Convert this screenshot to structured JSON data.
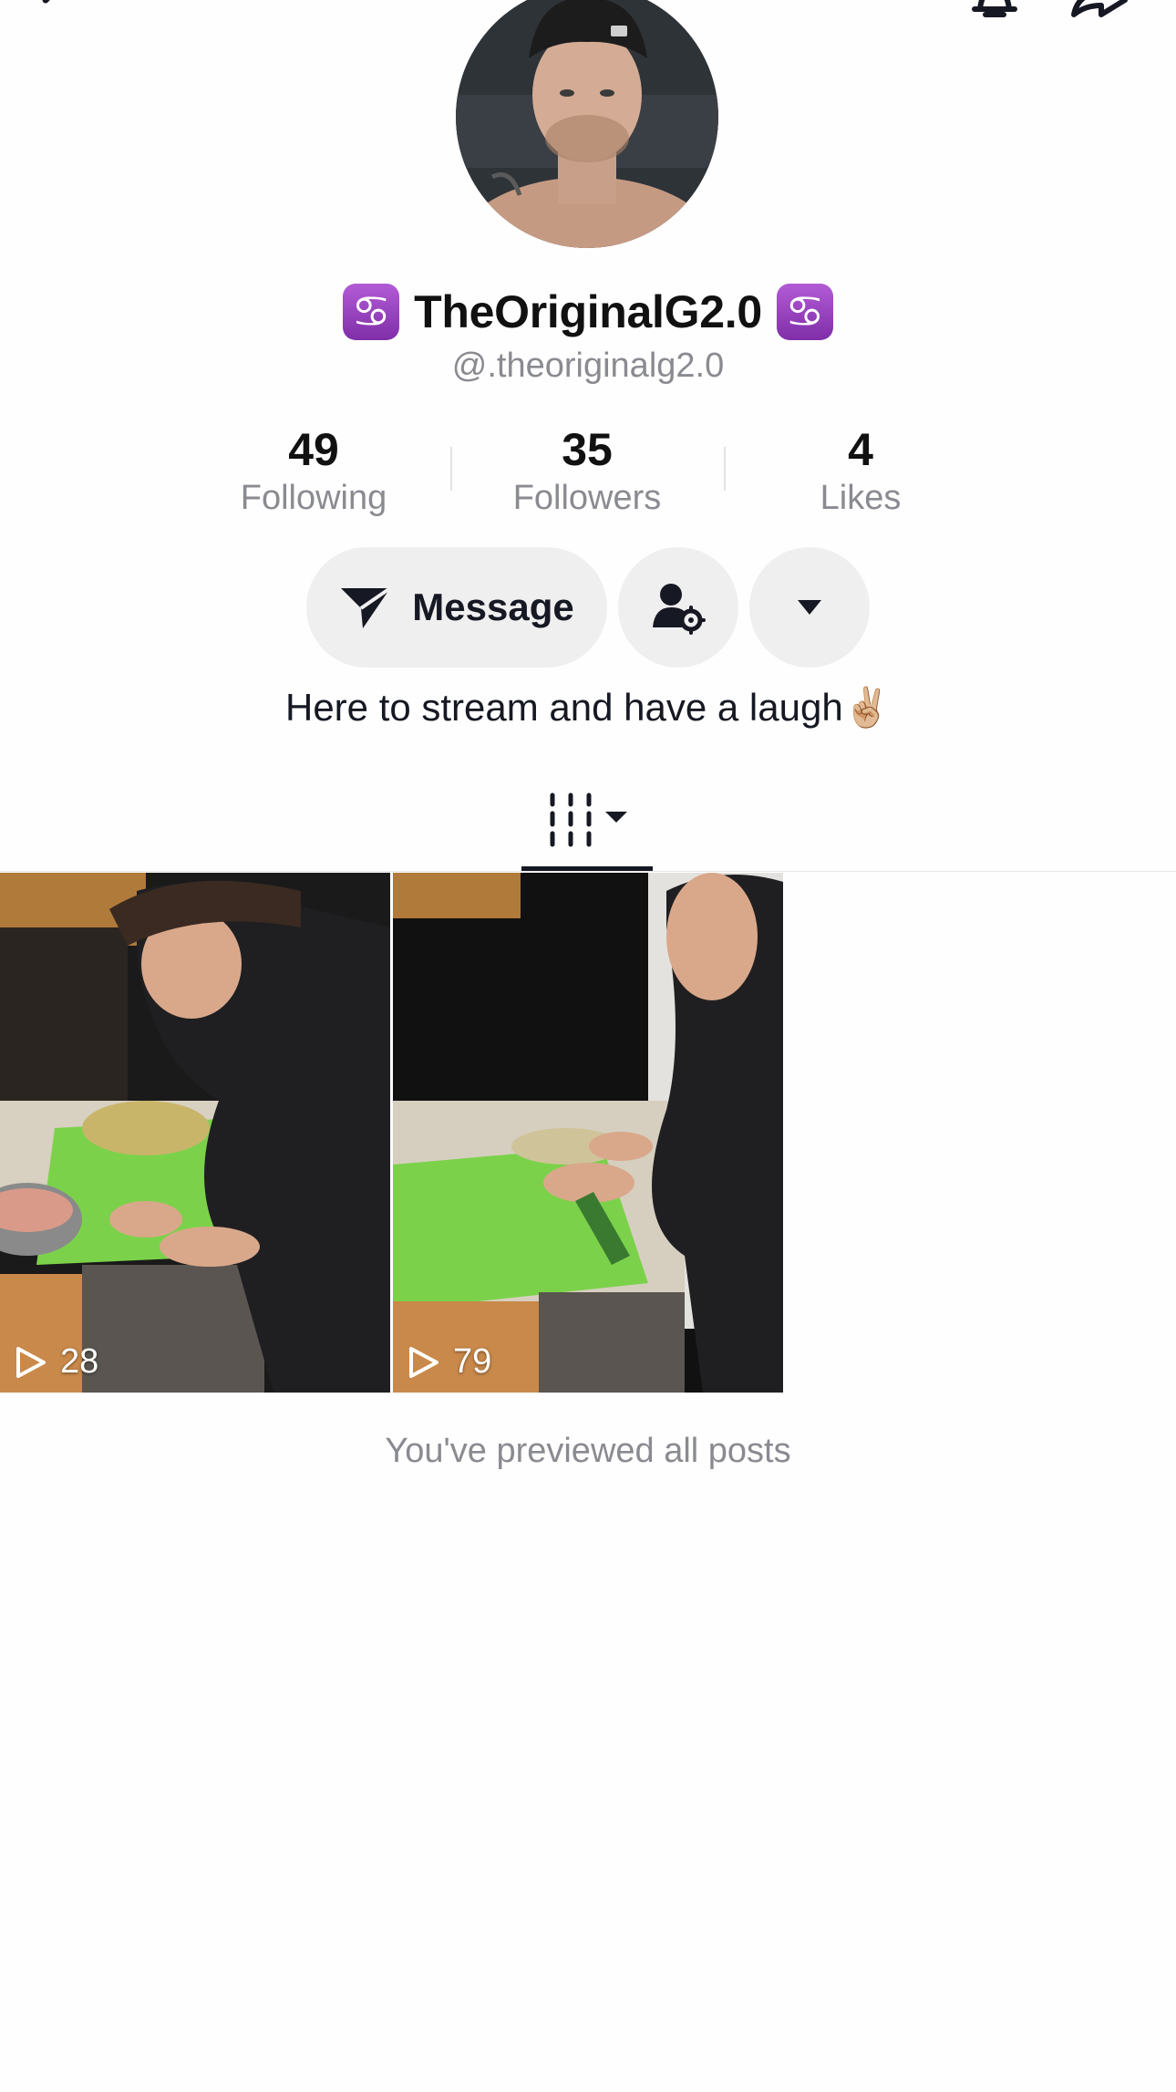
{
  "header": {
    "back_icon": "chevron-left-icon",
    "bell_icon": "bell-icon",
    "share_icon": "share-arrow-icon"
  },
  "profile": {
    "display_name": "TheOriginalG2.0",
    "name_emoji": "♋",
    "username": "@.theoriginalg2.0"
  },
  "stats": {
    "following": {
      "value": "49",
      "label": "Following"
    },
    "followers": {
      "value": "35",
      "label": "Followers"
    },
    "likes": {
      "value": "4",
      "label": "Likes"
    }
  },
  "actions": {
    "message_label": "Message",
    "message_icon": "send-icon",
    "profile_settings_icon": "user-gear-icon",
    "more_icon": "caret-down-icon"
  },
  "bio": "Here to stream and have a laugh✌🏼",
  "tabs": {
    "videos_icon": "videos-grid-icon"
  },
  "videos": [
    {
      "views": "28"
    },
    {
      "views": "79"
    }
  ],
  "footer_note": "You've previewed all posts",
  "colors": {
    "primary_text": "#161823",
    "secondary_text": "#8a8b91",
    "button_bg": "#efefef",
    "zodiac_purple": "#9a3fc4"
  }
}
